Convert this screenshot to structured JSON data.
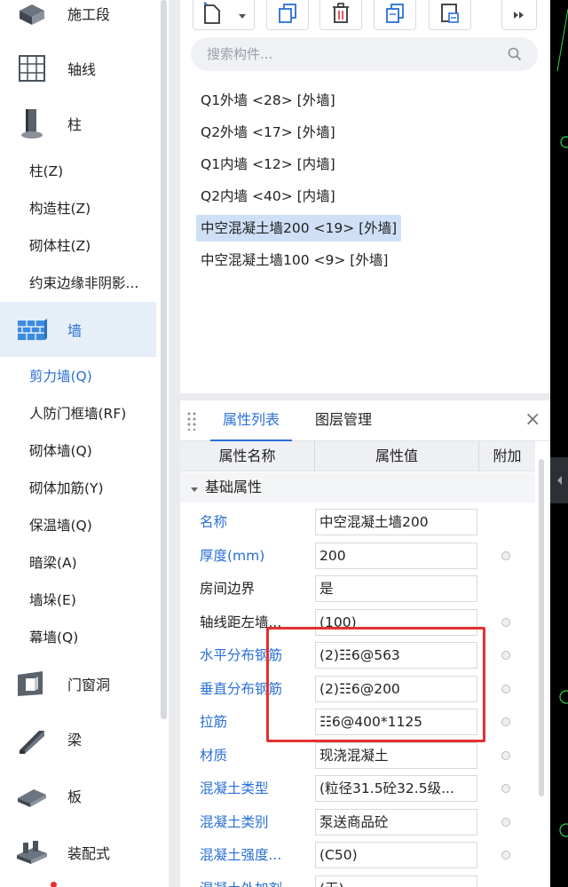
{
  "left_panel": {
    "categories": [
      {
        "label": "施工段",
        "icon": "construction-section-icon"
      },
      {
        "label": "轴线",
        "icon": "axis-grid-icon"
      },
      {
        "label": "柱",
        "icon": "column-icon"
      },
      {
        "label": "墙",
        "icon": "wall-brick-icon"
      },
      {
        "label": "门窗洞",
        "icon": "door-window-icon"
      },
      {
        "label": "梁",
        "icon": "beam-icon"
      },
      {
        "label": "板",
        "icon": "slab-icon"
      },
      {
        "label": "装配式",
        "icon": "prefab-icon"
      }
    ],
    "column_items": [
      "柱(Z)",
      "构造柱(Z)",
      "砌体柱(Z)",
      "约束边缘非阴影..."
    ],
    "wall_items": [
      "剪力墙(Q)",
      "人防门框墙(RF)",
      "砌体墙(Q)",
      "砌体加筋(Y)",
      "保温墙(Q)",
      "暗梁(A)",
      "墙垛(E)",
      "幕墙(Q)"
    ]
  },
  "toolbar": {
    "icons": [
      "new-component-icon",
      "dropdown-arrow-icon",
      "copy-icon",
      "delete-icon",
      "duplicate-layer-icon",
      "filter-icon",
      "more-icon"
    ]
  },
  "search": {
    "placeholder": "搜索构件..."
  },
  "components": [
    "Q1外墙 <28> [外墙]",
    "Q2外墙 <17> [外墙]",
    "Q1内墙 <12> [内墙]",
    "Q2内墙 <40> [内墙]",
    "中空混凝土墙200 <19> [外墙]",
    "中空混凝土墙100 <9> [外墙]"
  ],
  "selected_component_index": 4,
  "properties_panel": {
    "tabs": [
      "属性列表",
      "图层管理"
    ],
    "columns": [
      "属性名称",
      "属性值",
      "附加"
    ],
    "group": "基础属性",
    "rows": [
      {
        "name": "名称",
        "value": "中空混凝土墙200",
        "blue": true,
        "dot": false
      },
      {
        "name": "厚度(mm)",
        "value": "200",
        "blue": true,
        "dot": true
      },
      {
        "name": "房间边界",
        "value": "是",
        "blue": false,
        "dot": false
      },
      {
        "name": "轴线距左墙...",
        "value": "(100)",
        "blue": false,
        "dot": true
      },
      {
        "name": "水平分布钢筋",
        "value": "(2)☷6@563",
        "blue": true,
        "dot": true
      },
      {
        "name": "垂直分布钢筋",
        "value": "(2)☷6@200",
        "blue": true,
        "dot": true
      },
      {
        "name": "拉筋",
        "value": "☷6@400*1125",
        "blue": true,
        "dot": true
      },
      {
        "name": "材质",
        "value": "现浇混凝土",
        "blue": true,
        "dot": true
      },
      {
        "name": "混凝土类型",
        "value": "(粒径31.5砼32.5级...",
        "blue": true,
        "dot": true
      },
      {
        "name": "混凝土类别",
        "value": "泵送商品砼",
        "blue": true,
        "dot": true
      },
      {
        "name": "混凝土强度...",
        "value": "(C50)",
        "blue": true,
        "dot": true
      },
      {
        "name": "混凝土外加剂",
        "value": "(无)",
        "blue": true,
        "dot": false
      }
    ]
  },
  "colors": {
    "accent": "#2a6fd6",
    "highlight": "#e53030",
    "selection": "#cfe0f6"
  }
}
